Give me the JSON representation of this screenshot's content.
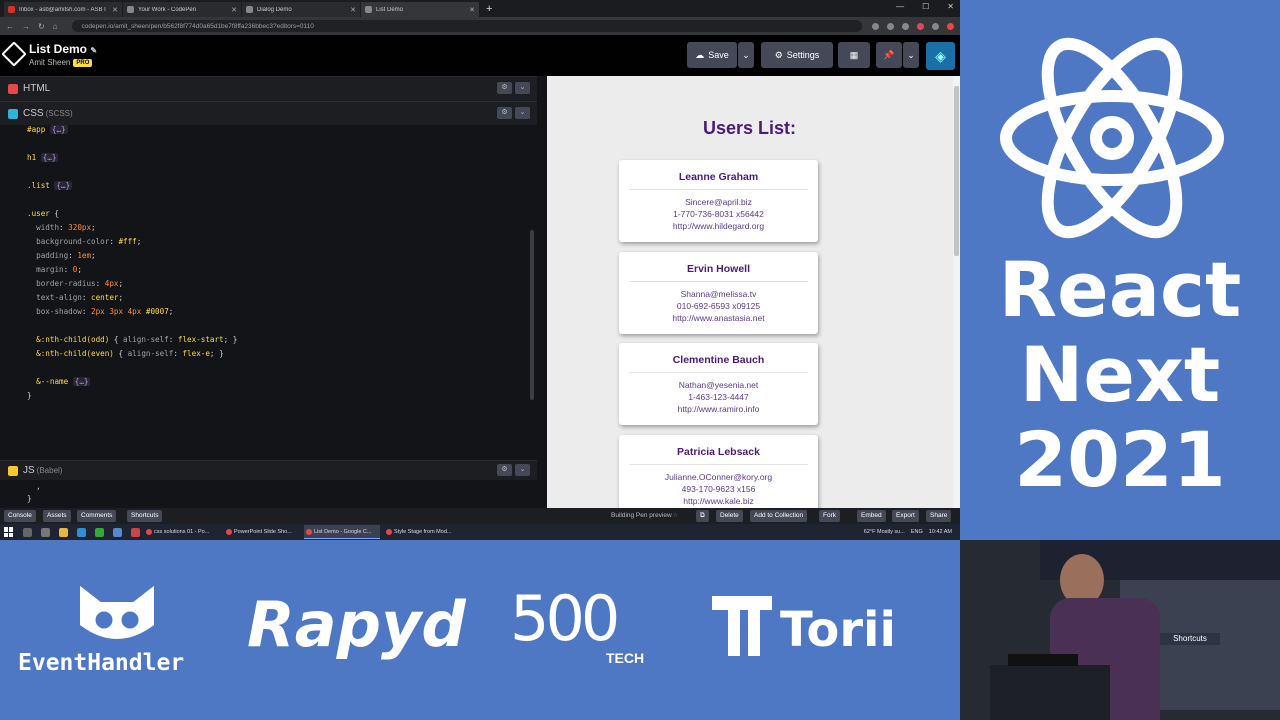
{
  "browser": {
    "tabs": [
      {
        "label": "Inbox - asb@amitsh.com - ASB I",
        "color": "#d93025"
      },
      {
        "label": "Your Work - CodePen",
        "color": "#999999"
      },
      {
        "label": "Dialog Demo",
        "color": "#999999"
      },
      {
        "label": "List Demo",
        "color": "#999999"
      }
    ],
    "url": "codepen.io/amit_sheen/pen/b562f8f774d0a65d1be7f8ffa236bbec3?editors=0110"
  },
  "codepen": {
    "title": "List Demo",
    "author": "Amit Sheen",
    "pro_badge": "PRO",
    "save_label": "Save",
    "settings_label": "Settings",
    "panels": {
      "html": "HTML",
      "css": "CSS",
      "css_sub": "(SCSS)",
      "js": "JS",
      "js_sub": "(Babel)"
    },
    "code_lines": [
      "#app {…}",
      "",
      "h1 {…}",
      "",
      ".list {…}",
      "",
      ".user {",
      "  width: 320px;",
      "  background-color: #fff;",
      "  padding: 1em;",
      "  margin: 0;",
      "  border-radius: 4px;",
      "  text-align: center;",
      "  box-shadow: 2px 3px 4px #0007;",
      "",
      "  &:nth-child(odd) { align-self: flex-start; }",
      "  &:nth-child(even) { align-self: flex-e; }",
      "",
      "  &--name {…}",
      "}"
    ],
    "js_lines": [
      "  ,",
      "}"
    ],
    "bottom": {
      "console": "Console",
      "assets": "Assets",
      "comments": "Comments",
      "shortcuts": "Shortcuts",
      "status": "Building Pen preview",
      "delete": "Delete",
      "add_collection": "Add to Collection",
      "fork": "Fork",
      "embed": "Embed",
      "export": "Export",
      "share": "Share"
    }
  },
  "preview": {
    "title": "Users List:",
    "users": [
      {
        "name": "Leanne Graham",
        "email": "Sincere@april.biz",
        "phone": "1-770-736-8031 x56442",
        "website": "http://www.hildegard.org"
      },
      {
        "name": "Ervin Howell",
        "email": "Shanna@melissa.tv",
        "phone": "010-692-6593 x09125",
        "website": "http://www.anastasia.net"
      },
      {
        "name": "Clementine Bauch",
        "email": "Nathan@yesenia.net",
        "phone": "1-463-123-4447",
        "website": "http://www.ramiro.info"
      },
      {
        "name": "Patricia Lebsack",
        "email": "Julianne.OConner@kory.org",
        "phone": "493-170-9623 x156",
        "website": "http://www.kale.biz"
      }
    ]
  },
  "taskbar": {
    "apps": [
      "css solutions 01 - Po...",
      "PowerPoint Slide Sho...",
      "List Demo - Google C...",
      "Style Stage from Mod..."
    ],
    "weather": "62°F  Mostly su...",
    "lang": "ENG",
    "time": "10:42 AM"
  },
  "slide": {
    "line1": "React",
    "line2": "Next",
    "line3": "2021"
  },
  "sponsors": {
    "s1": "EventHandler",
    "s2": "Rapyd",
    "s3": "500",
    "s3_sub": "TECH",
    "s4": "Torii"
  },
  "colors": {
    "brand_blue": "#4f78c4",
    "preview_purple": "#4a1a7c"
  }
}
